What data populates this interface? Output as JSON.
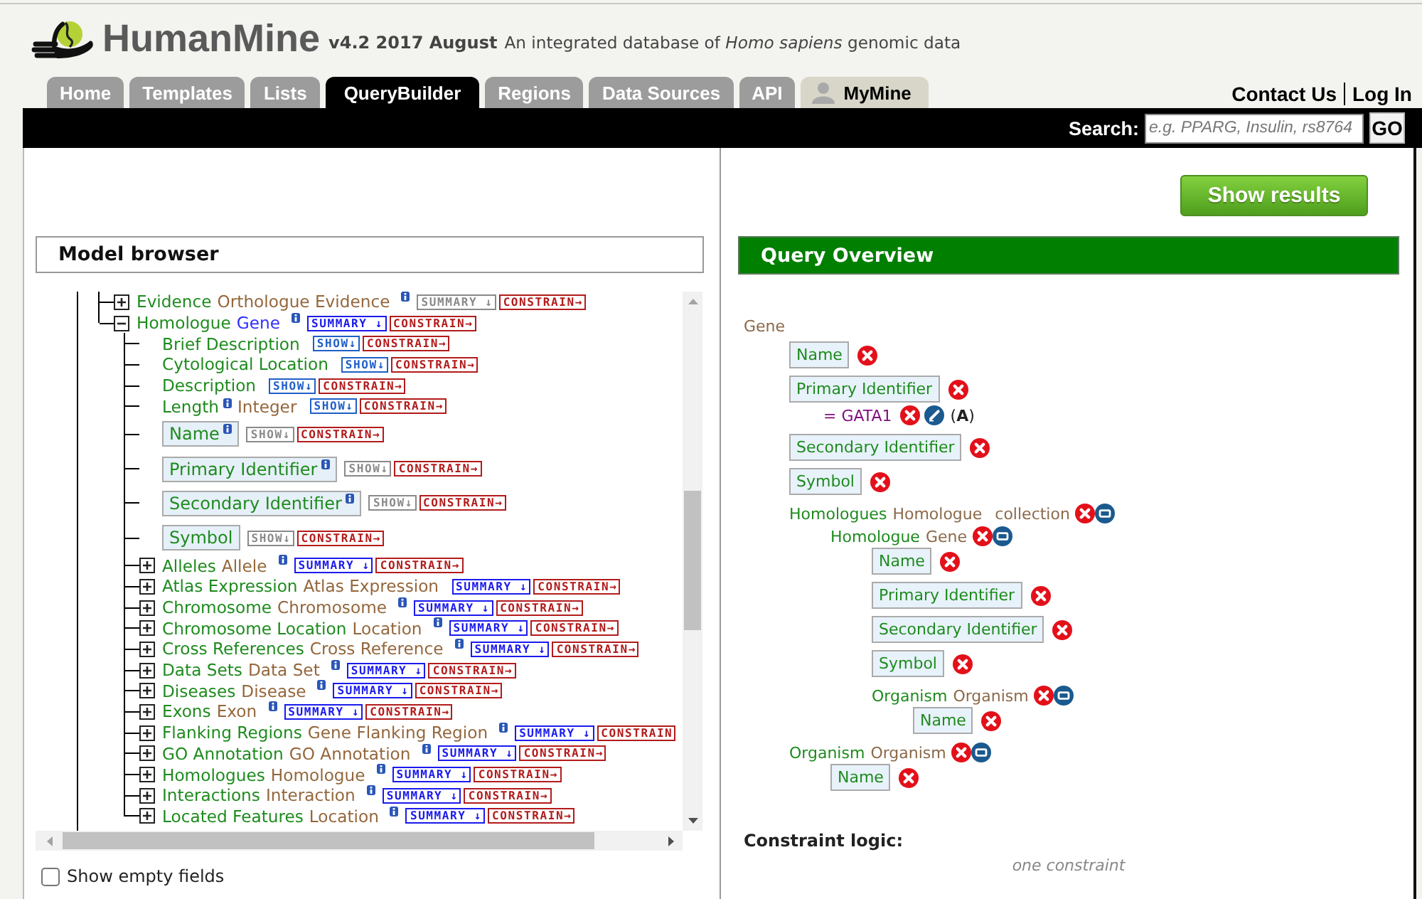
{
  "header": {
    "title": "HumanMine",
    "version": "v4.2 2017 August",
    "tagline": "An integrated database of *Homo sapiens* genomic data"
  },
  "tabs": [
    {
      "label": "Home",
      "selected": false,
      "kind": "page"
    },
    {
      "label": "Templates",
      "selected": false,
      "kind": "page"
    },
    {
      "label": "Lists",
      "selected": false,
      "kind": "page"
    },
    {
      "label": "QueryBuilder",
      "selected": true,
      "kind": "page"
    },
    {
      "label": "Regions",
      "selected": false,
      "kind": "page"
    },
    {
      "label": "Data Sources",
      "selected": false,
      "kind": "page"
    },
    {
      "label": "API",
      "selected": false,
      "kind": "page"
    },
    {
      "label": "MyMine",
      "selected": false,
      "kind": "account"
    }
  ],
  "user_links": [
    "Contact Us",
    "Log In"
  ],
  "search": {
    "label": "Search:",
    "placeholder": "e.g. PPARG, Insulin, rs8764",
    "button": "GO"
  },
  "show_results": "Show results",
  "model_browser": {
    "title": "Model browser",
    "tree": [
      {
        "kind": "reference",
        "name": "Evidence",
        "type": "Orthologue Evidence",
        "info": true,
        "expanded": false,
        "in_query": false,
        "action": {
          "label": "SUMMARY ↓",
          "disabled": true
        },
        "constrain": "CONSTRAIN→"
      },
      {
        "kind": "reference",
        "name": "Homologue",
        "type": "Gene",
        "info": true,
        "expanded": true,
        "in_query": true,
        "action": {
          "label": "SUMMARY ↓",
          "disabled": false
        },
        "constrain": "CONSTRAIN→",
        "children": [
          {
            "kind": "attribute",
            "name": "Brief Description",
            "info": false,
            "in_view": false,
            "action": {
              "label": "SHOW↓",
              "disabled": false
            },
            "constrain": "CONSTRAIN→"
          },
          {
            "kind": "attribute",
            "name": "Cytological Location",
            "info": false,
            "in_view": false,
            "action": {
              "label": "SHOW↓",
              "disabled": false
            },
            "constrain": "CONSTRAIN→"
          },
          {
            "kind": "attribute",
            "name": "Description",
            "info": false,
            "in_view": false,
            "action": {
              "label": "SHOW↓",
              "disabled": false
            },
            "constrain": "CONSTRAIN→"
          },
          {
            "kind": "attribute",
            "name": "Length",
            "type": "Integer",
            "info": true,
            "in_view": false,
            "action": {
              "label": "SHOW↓",
              "disabled": false
            },
            "constrain": "CONSTRAIN→"
          },
          {
            "kind": "attribute",
            "name": "Name",
            "info": true,
            "in_view": true,
            "action": {
              "label": "SHOW↓",
              "disabled": true
            },
            "constrain": "CONSTRAIN→"
          },
          {
            "kind": "attribute",
            "name": "Primary Identifier",
            "info": true,
            "in_view": true,
            "action": {
              "label": "SHOW↓",
              "disabled": true
            },
            "constrain": "CONSTRAIN→"
          },
          {
            "kind": "attribute",
            "name": "Secondary Identifier",
            "info": true,
            "in_view": true,
            "action": {
              "label": "SHOW↓",
              "disabled": true
            },
            "constrain": "CONSTRAIN→"
          },
          {
            "kind": "attribute",
            "name": "Symbol",
            "info": false,
            "in_view": true,
            "action": {
              "label": "SHOW↓",
              "disabled": true
            },
            "constrain": "CONSTRAIN→"
          },
          {
            "kind": "reference",
            "name": "Alleles",
            "type": "Allele",
            "info": true,
            "expanded": false,
            "in_query": false,
            "action": {
              "label": "SUMMARY ↓",
              "disabled": false
            },
            "constrain": "CONSTRAIN→"
          },
          {
            "kind": "reference",
            "name": "Atlas Expression",
            "type": "Atlas Expression",
            "info": false,
            "expanded": false,
            "in_query": false,
            "action": {
              "label": "SUMMARY ↓",
              "disabled": false
            },
            "constrain": "CONSTRAIN→"
          },
          {
            "kind": "reference",
            "name": "Chromosome",
            "type": "Chromosome",
            "info": true,
            "expanded": false,
            "in_query": false,
            "action": {
              "label": "SUMMARY ↓",
              "disabled": false
            },
            "constrain": "CONSTRAIN→"
          },
          {
            "kind": "reference",
            "name": "Chromosome Location",
            "type": "Location",
            "info": true,
            "expanded": false,
            "in_query": false,
            "action": {
              "label": "SUMMARY ↓",
              "disabled": false
            },
            "constrain": "CONSTRAIN→"
          },
          {
            "kind": "reference",
            "name": "Cross References",
            "type": "Cross Reference",
            "info": true,
            "expanded": false,
            "in_query": false,
            "action": {
              "label": "SUMMARY ↓",
              "disabled": false
            },
            "constrain": "CONSTRAIN→"
          },
          {
            "kind": "reference",
            "name": "Data Sets",
            "type": "Data Set",
            "info": true,
            "expanded": false,
            "in_query": false,
            "action": {
              "label": "SUMMARY ↓",
              "disabled": false
            },
            "constrain": "CONSTRAIN→"
          },
          {
            "kind": "reference",
            "name": "Diseases",
            "type": "Disease",
            "info": true,
            "expanded": false,
            "in_query": false,
            "action": {
              "label": "SUMMARY ↓",
              "disabled": false
            },
            "constrain": "CONSTRAIN→"
          },
          {
            "kind": "reference",
            "name": "Exons",
            "type": "Exon",
            "info": true,
            "expanded": false,
            "in_query": false,
            "action": {
              "label": "SUMMARY ↓",
              "disabled": false
            },
            "constrain": "CONSTRAIN→"
          },
          {
            "kind": "reference",
            "name": "Flanking Regions",
            "type": "Gene Flanking Region",
            "info": true,
            "expanded": false,
            "in_query": false,
            "action": {
              "label": "SUMMARY ↓",
              "disabled": false
            },
            "constrain": "CONSTRAIN"
          },
          {
            "kind": "reference",
            "name": "GO Annotation",
            "type": "GO Annotation",
            "info": true,
            "expanded": false,
            "in_query": false,
            "action": {
              "label": "SUMMARY ↓",
              "disabled": false
            },
            "constrain": "CONSTRAIN→"
          },
          {
            "kind": "reference",
            "name": "Homologues",
            "type": "Homologue",
            "info": true,
            "expanded": false,
            "in_query": false,
            "action": {
              "label": "SUMMARY ↓",
              "disabled": false
            },
            "constrain": "CONSTRAIN→"
          },
          {
            "kind": "reference",
            "name": "Interactions",
            "type": "Interaction",
            "info": true,
            "expanded": false,
            "in_query": false,
            "action": {
              "label": "SUMMARY ↓",
              "disabled": false
            },
            "constrain": "CONSTRAIN→"
          },
          {
            "kind": "reference",
            "name": "Located Features",
            "type": "Location",
            "info": true,
            "expanded": false,
            "in_query": false,
            "action": {
              "label": "SUMMARY ↓",
              "disabled": false
            },
            "constrain": "CONSTRAIN→"
          }
        ]
      }
    ],
    "show_empty_fields": {
      "label": "Show empty fields",
      "checked": false
    }
  },
  "query_overview": {
    "title": "Query Overview",
    "root": "Gene",
    "nodes": [
      {
        "kind": "attribute",
        "name": "Name"
      },
      {
        "kind": "attribute",
        "name": "Primary Identifier",
        "constraints": [
          {
            "text": "= GATA1",
            "code": "(**A**)"
          }
        ]
      },
      {
        "kind": "attribute",
        "name": "Secondary Identifier"
      },
      {
        "kind": "attribute",
        "name": "Symbol"
      },
      {
        "kind": "reference",
        "name": "Homologues",
        "type": "Homologue",
        "note": "collection",
        "children": [
          {
            "kind": "reference",
            "name": "Homologue",
            "type": "Gene",
            "children": [
              {
                "kind": "attribute",
                "name": "Name"
              },
              {
                "kind": "attribute",
                "name": "Primary Identifier"
              },
              {
                "kind": "attribute",
                "name": "Secondary Identifier"
              },
              {
                "kind": "attribute",
                "name": "Symbol"
              },
              {
                "kind": "reference",
                "name": "Organism",
                "type": "Organism",
                "children": [
                  {
                    "kind": "attribute",
                    "name": "Name"
                  }
                ]
              }
            ]
          }
        ]
      },
      {
        "kind": "reference",
        "name": "Organism",
        "type": "Organism",
        "children": [
          {
            "kind": "attribute",
            "name": "Name"
          }
        ]
      }
    ],
    "constraint_logic": {
      "label": "Constraint logic:",
      "text": "one constraint"
    }
  }
}
